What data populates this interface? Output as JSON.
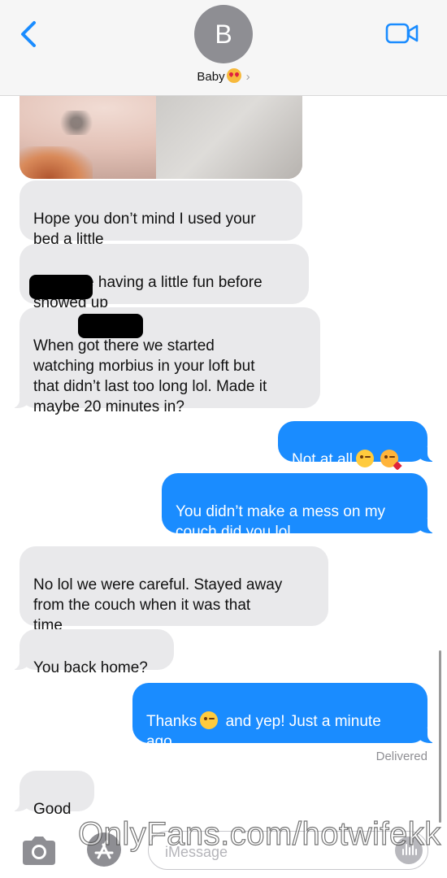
{
  "header": {
    "avatar_initial": "B",
    "contact_name": "Baby",
    "contact_emoji": "heart-eyes-emoji"
  },
  "messages": [
    {
      "dir": "received",
      "text": "Hope you don’t mind I used your\nbed a little"
    },
    {
      "dir": "received",
      "text": "We were having a little fun before\n            showed up"
    },
    {
      "dir": "received",
      "text": "When               got there we started\nwatching morbius in your loft but\nthat didn’t last too long lol. Made it\nmaybe 20 minutes in?"
    },
    {
      "dir": "sent",
      "text": "Not at all"
    },
    {
      "dir": "sent",
      "text": "You didn’t make a mess on my\ncouch did you lol"
    },
    {
      "dir": "received",
      "text": "No lol we were careful. Stayed away\nfrom the couch when it was that\ntime"
    },
    {
      "dir": "received",
      "text": "You back home?"
    },
    {
      "dir": "sent",
      "text_a": "Thanks",
      "text_b": " and yep! Just a minute\nago"
    },
    {
      "dir": "received",
      "text": "Good"
    }
  ],
  "status": {
    "delivered": "Delivered"
  },
  "composer": {
    "placeholder": "iMessage"
  },
  "watermark": "OnlyFans.com/hotwifekk",
  "colors": {
    "sent_bubble": "#1a8cff",
    "received_bubble": "#e9e9eb",
    "accent": "#1a8cff"
  },
  "icons": [
    "back-chevron-icon",
    "video-camera-icon",
    "camera-icon",
    "app-store-icon",
    "audio-waveform-icon",
    "smirk-emoji",
    "kiss-emoji",
    "wink-emoji"
  ]
}
